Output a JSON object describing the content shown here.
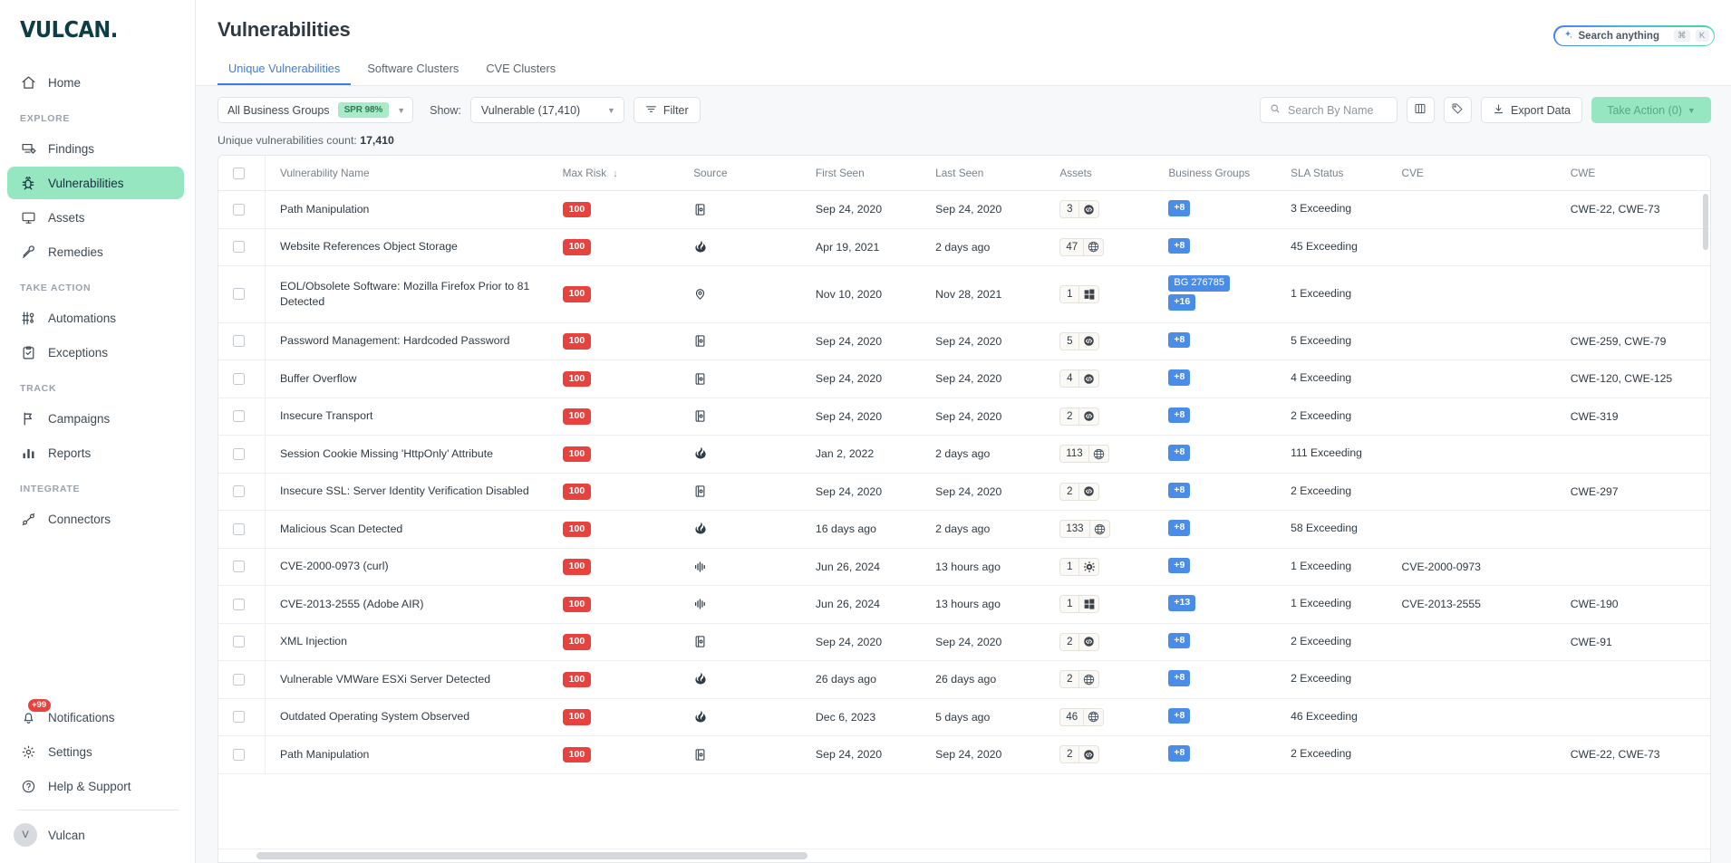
{
  "brand": {
    "name": "VULCAN",
    "dot": "."
  },
  "sidebar": {
    "home": {
      "label": "Home",
      "icon": "home-icon"
    },
    "sections": [
      {
        "label": "EXPLORE",
        "items": [
          {
            "label": "Findings",
            "icon": "findings-icon",
            "active": false
          },
          {
            "label": "Vulnerabilities",
            "icon": "bug-icon",
            "active": true
          },
          {
            "label": "Assets",
            "icon": "monitor-icon",
            "active": false
          },
          {
            "label": "Remedies",
            "icon": "wrench-icon",
            "active": false
          }
        ]
      },
      {
        "label": "TAKE ACTION",
        "items": [
          {
            "label": "Automations",
            "icon": "automations-icon",
            "active": false
          },
          {
            "label": "Exceptions",
            "icon": "clipboard-check-icon",
            "active": false
          }
        ]
      },
      {
        "label": "TRACK",
        "items": [
          {
            "label": "Campaigns",
            "icon": "flag-icon",
            "active": false
          },
          {
            "label": "Reports",
            "icon": "bar-chart-icon",
            "active": false
          }
        ]
      },
      {
        "label": "INTEGRATE",
        "items": [
          {
            "label": "Connectors",
            "icon": "connectors-icon",
            "active": false
          }
        ]
      }
    ],
    "bottom": {
      "notifications": {
        "label": "Notifications",
        "badge": "+99",
        "icon": "bell-icon"
      },
      "settings": {
        "label": "Settings",
        "icon": "gear-icon"
      },
      "help": {
        "label": "Help & Support",
        "icon": "question-circle-icon"
      },
      "user": {
        "label": "Vulcan",
        "initial": "V"
      }
    }
  },
  "header": {
    "title": "Vulnerabilities",
    "search": {
      "text": "Search anything",
      "kbd1": "⌘",
      "kbd2": "K",
      "icon": "sparkle-icon"
    },
    "tabs": [
      {
        "label": "Unique Vulnerabilities",
        "active": true
      },
      {
        "label": "Software Clusters",
        "active": false
      },
      {
        "label": "CVE Clusters",
        "active": false
      }
    ]
  },
  "toolbar": {
    "business_group": {
      "label": "All Business Groups",
      "chip": "SPR 98%"
    },
    "show_label": "Show:",
    "show_value": "Vulnerable (17,410)",
    "filter_label": "Filter",
    "search_by_name_placeholder": "Search By Name",
    "columns_icon": "columns-icon",
    "tag_icon": "tag-icon",
    "export_label": "Export Data",
    "take_action_label": "Take Action (0)"
  },
  "count_line": {
    "prefix": "Unique vulnerabilities count:",
    "value": "17,410"
  },
  "table": {
    "columns": [
      {
        "key": "name",
        "label": "Vulnerability Name"
      },
      {
        "key": "risk",
        "label": "Max Risk",
        "sorted": "desc"
      },
      {
        "key": "source",
        "label": "Source"
      },
      {
        "key": "first",
        "label": "First Seen"
      },
      {
        "key": "last",
        "label": "Last Seen"
      },
      {
        "key": "assets",
        "label": "Assets"
      },
      {
        "key": "bg",
        "label": "Business Groups"
      },
      {
        "key": "sla",
        "label": "SLA Status"
      },
      {
        "key": "cve",
        "label": "CVE"
      },
      {
        "key": "cwe",
        "label": "CWE"
      }
    ],
    "rows": [
      {
        "name": "Path Manipulation",
        "risk": "100",
        "source": "fortify-icon",
        "first": "Sep 24, 2020",
        "last": "Sep 24, 2020",
        "assets": "3",
        "asset_icon": "code-icon",
        "bg": [
          "+8"
        ],
        "sla": "3 Exceeding",
        "cve": "",
        "cwe": "CWE-22, CWE-73"
      },
      {
        "name": "Website References Object Storage",
        "risk": "100",
        "source": "burp-icon",
        "first": "Apr 19, 2021",
        "last": "2 days ago",
        "assets": "47",
        "asset_icon": "globe-icon",
        "bg": [
          "+8"
        ],
        "sla": "45 Exceeding",
        "cve": "",
        "cwe": ""
      },
      {
        "name": "EOL/Obsolete Software: Mozilla Firefox Prior to 81 Detected",
        "risk": "100",
        "source": "tenable-icon",
        "first": "Nov 10, 2020",
        "last": "Nov 28, 2021",
        "assets": "1",
        "asset_icon": "windows-icon",
        "bg": [
          "BG 276785",
          "+16"
        ],
        "sla": "1 Exceeding",
        "cve": "",
        "cwe": ""
      },
      {
        "name": "Password Management: Hardcoded Password",
        "risk": "100",
        "source": "fortify-icon",
        "first": "Sep 24, 2020",
        "last": "Sep 24, 2020",
        "assets": "5",
        "asset_icon": "code-icon",
        "bg": [
          "+8"
        ],
        "sla": "5 Exceeding",
        "cve": "",
        "cwe": "CWE-259, CWE-79"
      },
      {
        "name": "Buffer Overflow",
        "risk": "100",
        "source": "fortify-icon",
        "first": "Sep 24, 2020",
        "last": "Sep 24, 2020",
        "assets": "4",
        "asset_icon": "code-icon",
        "bg": [
          "+8"
        ],
        "sla": "4 Exceeding",
        "cve": "",
        "cwe": "CWE-120, CWE-125"
      },
      {
        "name": "Insecure Transport",
        "risk": "100",
        "source": "fortify-icon",
        "first": "Sep 24, 2020",
        "last": "Sep 24, 2020",
        "assets": "2",
        "asset_icon": "code-icon",
        "bg": [
          "+8"
        ],
        "sla": "2 Exceeding",
        "cve": "",
        "cwe": "CWE-319"
      },
      {
        "name": "Session Cookie Missing 'HttpOnly' Attribute",
        "risk": "100",
        "source": "burp-icon",
        "first": "Jan 2, 2022",
        "last": "2 days ago",
        "assets": "113",
        "asset_icon": "globe-icon",
        "bg": [
          "+8"
        ],
        "sla": "111 Exceeding",
        "cve": "",
        "cwe": ""
      },
      {
        "name": "Insecure SSL: Server Identity Verification Disabled",
        "risk": "100",
        "source": "fortify-icon",
        "first": "Sep 24, 2020",
        "last": "Sep 24, 2020",
        "assets": "2",
        "asset_icon": "code-icon",
        "bg": [
          "+8"
        ],
        "sla": "2 Exceeding",
        "cve": "",
        "cwe": "CWE-297"
      },
      {
        "name": "Malicious Scan Detected",
        "risk": "100",
        "source": "burp-icon",
        "first": "16 days ago",
        "last": "2 days ago",
        "assets": "133",
        "asset_icon": "globe-icon",
        "bg": [
          "+8"
        ],
        "sla": "58 Exceeding",
        "cve": "",
        "cwe": ""
      },
      {
        "name": "CVE-2000-0973 (curl)",
        "risk": "100",
        "source": "wave-icon",
        "first": "Jun 26, 2024",
        "last": "13 hours ago",
        "assets": "1",
        "asset_icon": "linux-icon",
        "bg": [
          "+9"
        ],
        "sla": "1 Exceeding",
        "cve": "CVE-2000-0973",
        "cwe": ""
      },
      {
        "name": "CVE-2013-2555 (Adobe AIR)",
        "risk": "100",
        "source": "wave-icon",
        "first": "Jun 26, 2024",
        "last": "13 hours ago",
        "assets": "1",
        "asset_icon": "windows-icon",
        "bg": [
          "+13"
        ],
        "sla": "1 Exceeding",
        "cve": "CVE-2013-2555",
        "cwe": "CWE-190"
      },
      {
        "name": "XML Injection",
        "risk": "100",
        "source": "fortify-icon",
        "first": "Sep 24, 2020",
        "last": "Sep 24, 2020",
        "assets": "2",
        "asset_icon": "code-icon",
        "bg": [
          "+8"
        ],
        "sla": "2 Exceeding",
        "cve": "",
        "cwe": "CWE-91"
      },
      {
        "name": "Vulnerable VMWare ESXi Server Detected",
        "risk": "100",
        "source": "burp-icon",
        "first": "26 days ago",
        "last": "26 days ago",
        "assets": "2",
        "asset_icon": "globe-icon",
        "bg": [
          "+8"
        ],
        "sla": "2 Exceeding",
        "cve": "",
        "cwe": ""
      },
      {
        "name": "Outdated Operating System Observed",
        "risk": "100",
        "source": "burp-icon",
        "first": "Dec 6, 2023",
        "last": "5 days ago",
        "assets": "46",
        "asset_icon": "globe-icon",
        "bg": [
          "+8"
        ],
        "sla": "46 Exceeding",
        "cve": "",
        "cwe": ""
      },
      {
        "name": "Path Manipulation",
        "risk": "100",
        "source": "fortify-icon",
        "first": "Sep 24, 2020",
        "last": "Sep 24, 2020",
        "assets": "2",
        "asset_icon": "code-icon",
        "bg": [
          "+8"
        ],
        "sla": "2 Exceeding",
        "cve": "",
        "cwe": "CWE-22, CWE-73"
      }
    ]
  },
  "colors": {
    "accent_green": "#96e6c1",
    "risk_red": "#e8423f",
    "bg_blue": "#4a8de8",
    "tab_blue": "#3b7de0",
    "brand_teal": "#0f3d46"
  }
}
